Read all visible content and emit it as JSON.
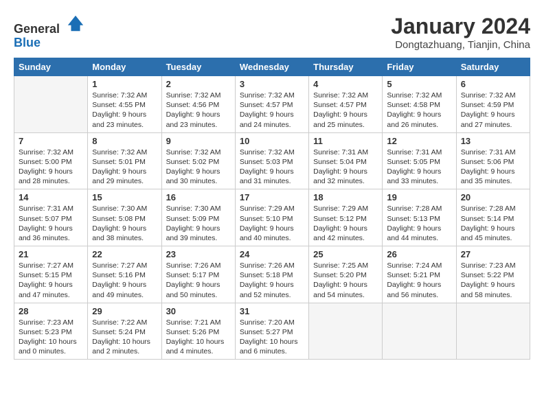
{
  "header": {
    "logo_line1": "General",
    "logo_line2": "Blue",
    "title": "January 2024",
    "subtitle": "Dongtazhuang, Tianjin, China"
  },
  "days_of_week": [
    "Sunday",
    "Monday",
    "Tuesday",
    "Wednesday",
    "Thursday",
    "Friday",
    "Saturday"
  ],
  "weeks": [
    [
      {
        "day": "",
        "empty": true
      },
      {
        "day": "1",
        "sunrise": "7:32 AM",
        "sunset": "4:55 PM",
        "daylight": "9 hours and 23 minutes."
      },
      {
        "day": "2",
        "sunrise": "7:32 AM",
        "sunset": "4:56 PM",
        "daylight": "9 hours and 23 minutes."
      },
      {
        "day": "3",
        "sunrise": "7:32 AM",
        "sunset": "4:57 PM",
        "daylight": "9 hours and 24 minutes."
      },
      {
        "day": "4",
        "sunrise": "7:32 AM",
        "sunset": "4:57 PM",
        "daylight": "9 hours and 25 minutes."
      },
      {
        "day": "5",
        "sunrise": "7:32 AM",
        "sunset": "4:58 PM",
        "daylight": "9 hours and 26 minutes."
      },
      {
        "day": "6",
        "sunrise": "7:32 AM",
        "sunset": "4:59 PM",
        "daylight": "9 hours and 27 minutes."
      }
    ],
    [
      {
        "day": "7",
        "sunrise": "7:32 AM",
        "sunset": "5:00 PM",
        "daylight": "9 hours and 28 minutes."
      },
      {
        "day": "8",
        "sunrise": "7:32 AM",
        "sunset": "5:01 PM",
        "daylight": "9 hours and 29 minutes."
      },
      {
        "day": "9",
        "sunrise": "7:32 AM",
        "sunset": "5:02 PM",
        "daylight": "9 hours and 30 minutes."
      },
      {
        "day": "10",
        "sunrise": "7:32 AM",
        "sunset": "5:03 PM",
        "daylight": "9 hours and 31 minutes."
      },
      {
        "day": "11",
        "sunrise": "7:31 AM",
        "sunset": "5:04 PM",
        "daylight": "9 hours and 32 minutes."
      },
      {
        "day": "12",
        "sunrise": "7:31 AM",
        "sunset": "5:05 PM",
        "daylight": "9 hours and 33 minutes."
      },
      {
        "day": "13",
        "sunrise": "7:31 AM",
        "sunset": "5:06 PM",
        "daylight": "9 hours and 35 minutes."
      }
    ],
    [
      {
        "day": "14",
        "sunrise": "7:31 AM",
        "sunset": "5:07 PM",
        "daylight": "9 hours and 36 minutes."
      },
      {
        "day": "15",
        "sunrise": "7:30 AM",
        "sunset": "5:08 PM",
        "daylight": "9 hours and 38 minutes."
      },
      {
        "day": "16",
        "sunrise": "7:30 AM",
        "sunset": "5:09 PM",
        "daylight": "9 hours and 39 minutes."
      },
      {
        "day": "17",
        "sunrise": "7:29 AM",
        "sunset": "5:10 PM",
        "daylight": "9 hours and 40 minutes."
      },
      {
        "day": "18",
        "sunrise": "7:29 AM",
        "sunset": "5:12 PM",
        "daylight": "9 hours and 42 minutes."
      },
      {
        "day": "19",
        "sunrise": "7:28 AM",
        "sunset": "5:13 PM",
        "daylight": "9 hours and 44 minutes."
      },
      {
        "day": "20",
        "sunrise": "7:28 AM",
        "sunset": "5:14 PM",
        "daylight": "9 hours and 45 minutes."
      }
    ],
    [
      {
        "day": "21",
        "sunrise": "7:27 AM",
        "sunset": "5:15 PM",
        "daylight": "9 hours and 47 minutes."
      },
      {
        "day": "22",
        "sunrise": "7:27 AM",
        "sunset": "5:16 PM",
        "daylight": "9 hours and 49 minutes."
      },
      {
        "day": "23",
        "sunrise": "7:26 AM",
        "sunset": "5:17 PM",
        "daylight": "9 hours and 50 minutes."
      },
      {
        "day": "24",
        "sunrise": "7:26 AM",
        "sunset": "5:18 PM",
        "daylight": "9 hours and 52 minutes."
      },
      {
        "day": "25",
        "sunrise": "7:25 AM",
        "sunset": "5:20 PM",
        "daylight": "9 hours and 54 minutes."
      },
      {
        "day": "26",
        "sunrise": "7:24 AM",
        "sunset": "5:21 PM",
        "daylight": "9 hours and 56 minutes."
      },
      {
        "day": "27",
        "sunrise": "7:23 AM",
        "sunset": "5:22 PM",
        "daylight": "9 hours and 58 minutes."
      }
    ],
    [
      {
        "day": "28",
        "sunrise": "7:23 AM",
        "sunset": "5:23 PM",
        "daylight": "10 hours and 0 minutes."
      },
      {
        "day": "29",
        "sunrise": "7:22 AM",
        "sunset": "5:24 PM",
        "daylight": "10 hours and 2 minutes."
      },
      {
        "day": "30",
        "sunrise": "7:21 AM",
        "sunset": "5:26 PM",
        "daylight": "10 hours and 4 minutes."
      },
      {
        "day": "31",
        "sunrise": "7:20 AM",
        "sunset": "5:27 PM",
        "daylight": "10 hours and 6 minutes."
      },
      {
        "day": "",
        "empty": true
      },
      {
        "day": "",
        "empty": true
      },
      {
        "day": "",
        "empty": true
      }
    ]
  ]
}
